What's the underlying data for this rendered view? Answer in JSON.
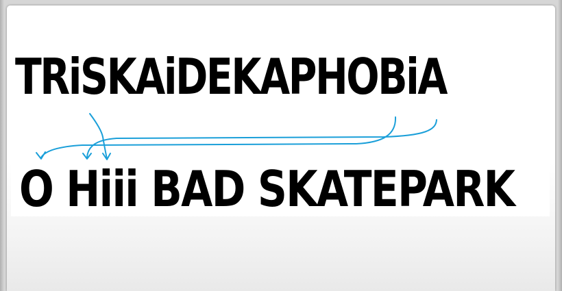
{
  "image": {
    "word": "TRiSKAiDEKAPHOBiA",
    "phrase": "O Hiii BAD SKATEPARK"
  },
  "colors": {
    "text": "#000000",
    "arrow": "#1a9fd9",
    "card": "#ffffff",
    "frame": "#d6d6d6"
  }
}
